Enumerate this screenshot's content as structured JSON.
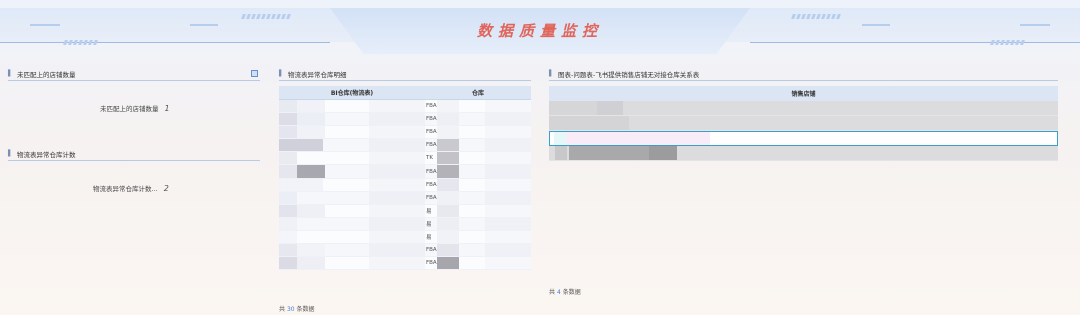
{
  "header": {
    "title": "数据质量监控"
  },
  "left": {
    "panel1": {
      "title": "未匹配上的店铺数量",
      "kpi_label": "未匹配上的店铺数量",
      "kpi_value": "1"
    },
    "panel2": {
      "title": "物流表异常仓库计数",
      "kpi_label": "物流表异常仓库计数...",
      "kpi_value": "2"
    }
  },
  "middle": {
    "title": "物流表异常仓库明细",
    "columns": [
      "BI仓库(物流表)",
      "仓库"
    ],
    "rows": [
      {
        "warehouse": "FBA"
      },
      {
        "warehouse": "FBA"
      },
      {
        "warehouse": "FBA"
      },
      {
        "warehouse": "FBA"
      },
      {
        "warehouse": "TK"
      },
      {
        "warehouse": "FBA"
      },
      {
        "warehouse": "FBA"
      },
      {
        "warehouse": "FBA"
      },
      {
        "warehouse": "易"
      },
      {
        "warehouse": "易"
      },
      {
        "warehouse": "易"
      },
      {
        "warehouse": "FBA"
      },
      {
        "warehouse": "FBA"
      }
    ],
    "footer": {
      "prefix": "共",
      "count": "30",
      "suffix": "条数据"
    }
  },
  "right": {
    "title": "图表-问题表-飞书提供销售店铺无对接仓库关系表",
    "column": "销售店铺",
    "footer": {
      "prefix": "共",
      "count": "4",
      "suffix": "条数据"
    }
  },
  "colors": {
    "accent": "#e0655a",
    "selection": "#3aa0c8",
    "header_bg": "#dbe5f3"
  },
  "icons": {
    "panel_marker": "bar-icon",
    "export": "export-icon"
  }
}
